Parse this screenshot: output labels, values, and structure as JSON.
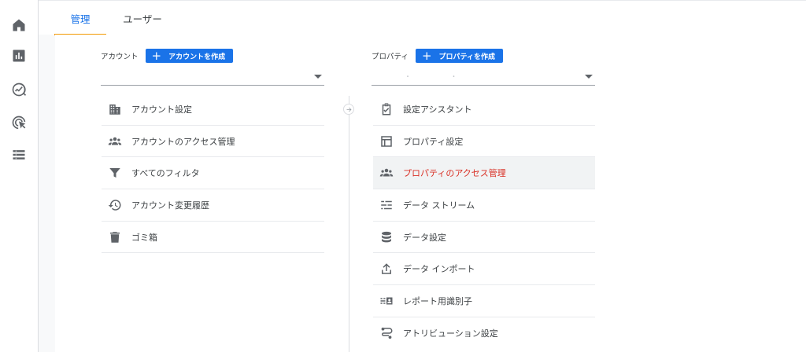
{
  "rail": {
    "items": [
      {
        "name": "home-icon"
      },
      {
        "name": "reports-icon"
      },
      {
        "name": "explore-icon"
      },
      {
        "name": "advertising-icon"
      },
      {
        "name": "configure-icon"
      }
    ]
  },
  "tabs": [
    {
      "label": "管理",
      "active": true
    },
    {
      "label": "ユーザー",
      "active": false
    }
  ],
  "account": {
    "label": "アカウント",
    "create_label": "アカウントを作成",
    "menu": [
      {
        "label": "アカウント設定",
        "icon": "building-icon"
      },
      {
        "label": "アカウントのアクセス管理",
        "icon": "people-icon"
      },
      {
        "label": "すべてのフィルタ",
        "icon": "filter-icon"
      },
      {
        "label": "アカウント変更履歴",
        "icon": "history-icon"
      },
      {
        "label": "ゴミ箱",
        "icon": "trash-icon"
      }
    ]
  },
  "property": {
    "label": "プロパティ",
    "create_label": "プロパティを作成",
    "select_value": "・ ・",
    "menu": [
      {
        "label": "設定アシスタント",
        "icon": "clipboard-check-icon"
      },
      {
        "label": "プロパティ設定",
        "icon": "property-settings-icon"
      },
      {
        "label": "プロパティのアクセス管理",
        "icon": "people-icon",
        "selected": true
      },
      {
        "label": "データ ストリーム",
        "icon": "data-streams-icon"
      },
      {
        "label": "データ設定",
        "icon": "database-icon"
      },
      {
        "label": "データ インポート",
        "icon": "upload-icon"
      },
      {
        "label": "レポート用識別子",
        "icon": "identity-icon"
      },
      {
        "label": "アトリビューション設定",
        "icon": "attribution-icon"
      }
    ]
  },
  "colors": {
    "accent": "#1a73e8",
    "tab_indicator": "#f29900",
    "selected_text": "#d93025"
  }
}
